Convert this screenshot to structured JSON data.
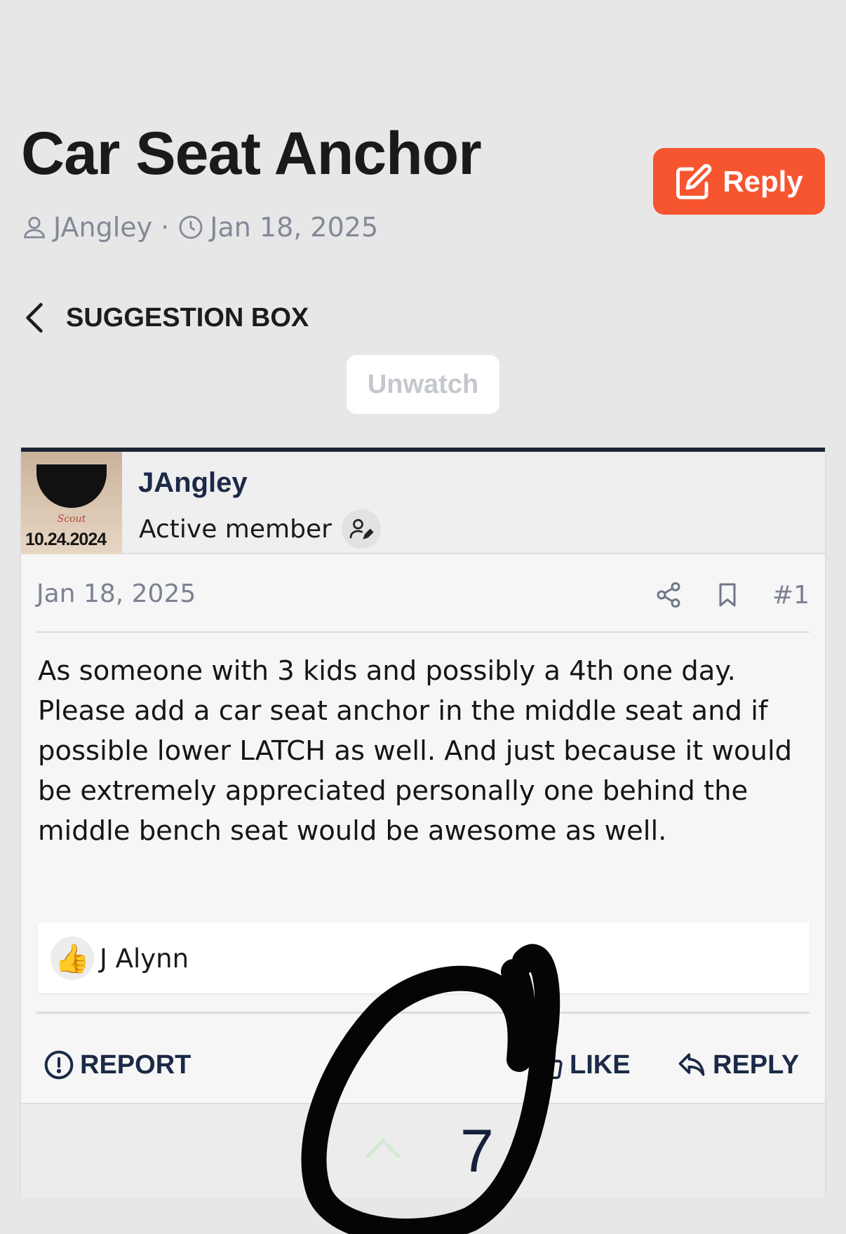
{
  "thread": {
    "title": "Car Seat Anchor",
    "author": "JAngley",
    "separator": "·",
    "date": "Jan 18, 2025"
  },
  "actions": {
    "reply_label": "Reply",
    "unwatch_label": "Unwatch"
  },
  "breadcrumb": {
    "label": "SUGGESTION BOX"
  },
  "post": {
    "author": "JAngley",
    "role": "Active member",
    "avatar_text": "10.24.2024",
    "avatar_script": "Scout",
    "date": "Jan 18, 2025",
    "number": "#1",
    "body": "As someone with 3 kids and possibly a 4th one day. Please add a car seat anchor in the middle seat and if possible lower LATCH as well. And just because it would be extremely appreciated personally one behind the middle bench seat would be awesome as well.",
    "reaction_emoji": "👍",
    "reaction_users": "J Alynn",
    "footer": {
      "report": "REPORT",
      "like": "LIKE",
      "reply": "REPLY"
    },
    "vote_count": "7"
  },
  "colors": {
    "accent": "#f65530",
    "navy": "#1b2a47",
    "page_bg": "#e7e7e8"
  },
  "icons": [
    "user-icon",
    "clock-icon",
    "chevron-left-icon",
    "edit-icon",
    "user-edit-icon",
    "share-icon",
    "bookmark-icon",
    "alert-circle-icon",
    "thumbs-up-icon",
    "reply-arrow-icon",
    "chevron-up-icon"
  ]
}
